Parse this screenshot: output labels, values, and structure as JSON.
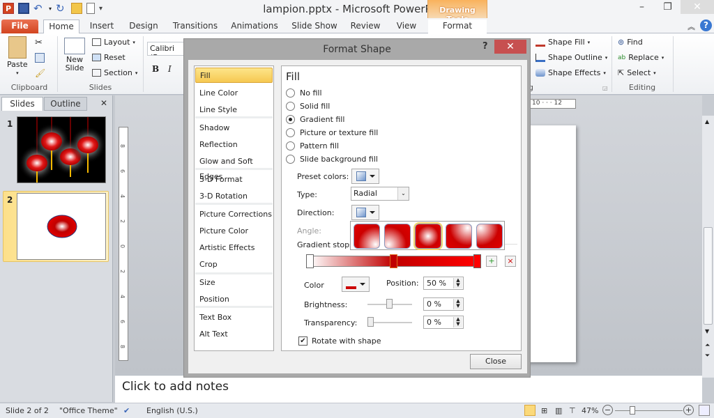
{
  "window": {
    "title": "lampion.pptx  -  Microsoft PowerPoint",
    "contextual_tab_group": "Drawing Tools",
    "controls": {
      "minimize": "–",
      "restore": "❐",
      "close": "✕"
    }
  },
  "tabs": [
    "File",
    "Home",
    "Insert",
    "Design",
    "Transitions",
    "Animations",
    "Slide Show",
    "Review",
    "View",
    "Format"
  ],
  "ribbon": {
    "clipboard": {
      "paste": "Paste",
      "label": "Clipboard"
    },
    "slides": {
      "new_slide": "New Slide",
      "layout": "Layout",
      "reset": "Reset",
      "section": "Section",
      "label": "Slides"
    },
    "font": {
      "font_name": "Calibri (Bo",
      "bold": "B",
      "italic": "I"
    },
    "drawing": {
      "shape_fill": "Shape Fill",
      "shape_outline": "Shape Outline",
      "shape_effects": "Shape Effects",
      "label": "g"
    },
    "editing": {
      "find": "Find",
      "replace": "Replace",
      "select": "Select",
      "label": "Editing"
    }
  },
  "slides_panel": {
    "tabs": [
      "Slides",
      "Outline"
    ],
    "close": "✕",
    "thumbnails": [
      {
        "number": "1"
      },
      {
        "number": "2"
      }
    ]
  },
  "ruler": {
    "horizontal_visible": "10 · · · 12",
    "vertical_labels": [
      "8",
      "6",
      "4",
      "2",
      "0",
      "2",
      "4",
      "6",
      "8"
    ]
  },
  "notes": {
    "placeholder": "Click to add notes"
  },
  "status": {
    "slide": "Slide 2 of 2",
    "theme": "\"Office Theme\"",
    "language": "English (U.S.)",
    "zoom": "47%",
    "zoom_fraction": 0.47
  },
  "dialog": {
    "title": "Format Shape",
    "help": "?",
    "close": "✕",
    "nav_items": [
      "Fill",
      "Line Color",
      "Line Style",
      "Shadow",
      "Reflection",
      "Glow and Soft Edges",
      "3-D Format",
      "3-D Rotation",
      "Picture Corrections",
      "Picture Color",
      "Artistic Effects",
      "Crop",
      "Size",
      "Position",
      "Text Box",
      "Alt Text"
    ],
    "selected_nav": "Fill",
    "fill": {
      "heading": "Fill",
      "options": [
        "No fill",
        "Solid fill",
        "Gradient fill",
        "Picture or texture fill",
        "Pattern fill",
        "Slide background fill"
      ],
      "selected_option": "Gradient fill",
      "preset_colors_label": "Preset colors:",
      "type_label": "Type:",
      "type_value": "Radial",
      "direction_label": "Direction:",
      "angle_label": "Angle:",
      "gradient_stops_label": "Gradient stops",
      "direction_options": [
        "From Bottom Right Corner",
        "From Bottom Left Corner",
        "From Center",
        "From Top Right Corner",
        "From Top Left Corner"
      ],
      "selected_direction_index": 2,
      "stops": [
        {
          "position": 0,
          "color": "#ffffff"
        },
        {
          "position": 50,
          "color": "#c00000"
        },
        {
          "position": 100,
          "color": "#ff0000"
        }
      ],
      "selected_stop_index": 1,
      "color_label": "Color",
      "position_label": "Position:",
      "position_value": "50 %",
      "brightness_label": "Brightness:",
      "brightness_value": "0 %",
      "transparency_label": "Transparency:",
      "transparency_value": "0 %",
      "rotate_label": "Rotate with shape",
      "rotate_checked": true
    },
    "close_button": "Close"
  },
  "colors": {
    "accent_file": "#d2441f",
    "selection": "#f6c851",
    "gradient_red": "#cc0000",
    "dialog_close": "#c75050"
  }
}
